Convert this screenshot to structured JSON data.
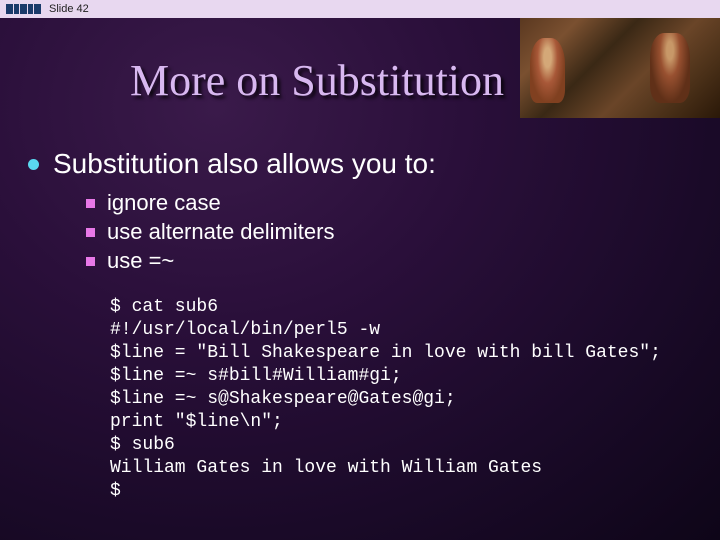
{
  "slide_label": "Slide 42",
  "title": "More on Substitution",
  "main_point": "Substitution also allows you to:",
  "sub_points": [
    "ignore case",
    "use alternate delimiters",
    "use =~"
  ],
  "code_lines": [
    "$ cat sub6",
    "#!/usr/local/bin/perl5 -w",
    "$line = \"Bill Shakespeare in love with bill Gates\";",
    "$line =~ s#bill#William#gi;",
    "$line =~ s@Shakespeare@Gates@gi;",
    "print \"$line\\n\";",
    "$ sub6",
    "William Gates in love with William Gates",
    "$"
  ]
}
